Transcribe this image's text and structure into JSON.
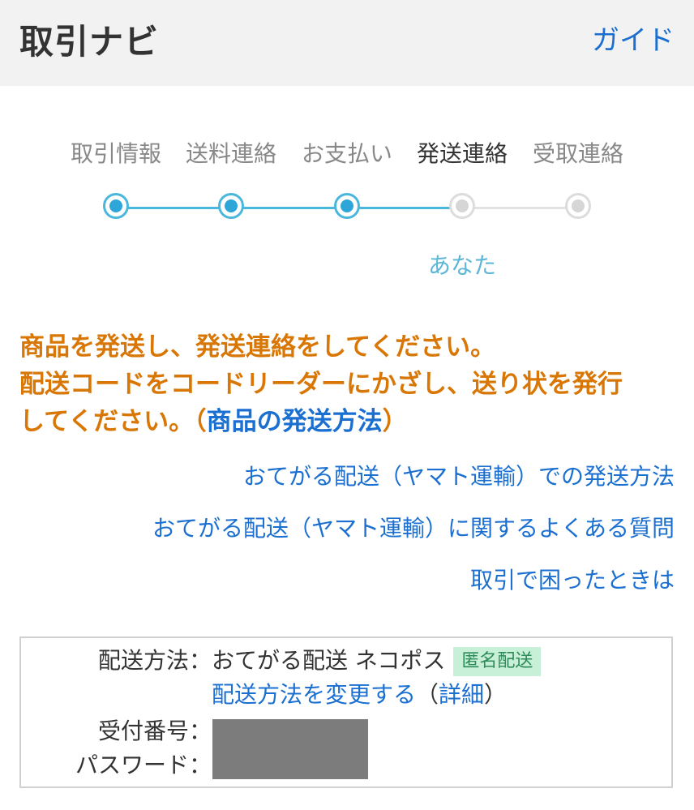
{
  "header": {
    "title": "取引ナビ",
    "guide_link": "ガイド"
  },
  "steps": [
    {
      "label": "取引情報",
      "status": "done"
    },
    {
      "label": "送料連絡",
      "status": "done"
    },
    {
      "label": "お支払い",
      "status": "done"
    },
    {
      "label": "発送連絡",
      "status": "current"
    },
    {
      "label": "受取連絡",
      "status": "todo"
    }
  ],
  "current_actor": "あなた",
  "instructions": {
    "line1": "商品を発送し、発送連絡をしてください。",
    "line2": "配送コードをコードリーダーにかざし、送り状を発行",
    "line3_prefix": "してください。（",
    "line3_link": "商品の発送方法",
    "line3_suffix": "）"
  },
  "help_links": [
    "おてがる配送（ヤマト運輸）での発送方法",
    "おてがる配送（ヤマト運輸）に関するよくある質問",
    "取引で困ったときは"
  ],
  "shipping_info": {
    "method_label": "配送方法：",
    "method_value": "おてがる配送 ネコポス",
    "badge": "匿名配送",
    "change_link": "配送方法を変更する",
    "detail_open": "（",
    "detail_link": "詳細",
    "detail_close": "）",
    "receipt_label": "受付番号：",
    "password_label": "パスワード："
  },
  "colors": {
    "accent_blue": "#1a6fd0",
    "step_done": "#2fa6d8",
    "instruction_orange": "#d97706",
    "badge_bg": "#c8f0d8"
  }
}
